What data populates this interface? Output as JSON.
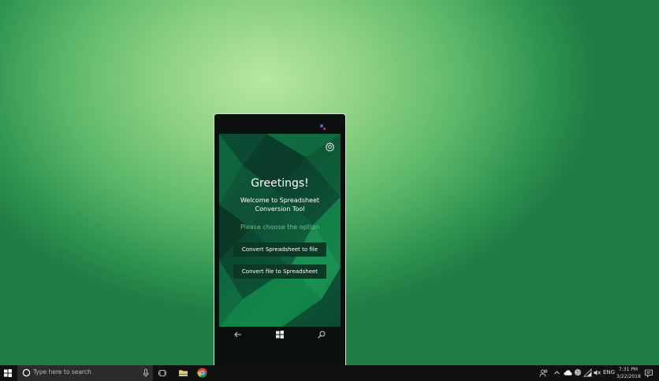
{
  "app": {
    "greeting": "Greetings!",
    "welcome_line1": "Welcome to Spreadsheet",
    "welcome_line2": "Conversion Tool",
    "choose_prompt": "Please choose the option",
    "buttons": {
      "convert_to_file": "Convert Spreadsheet to file",
      "convert_to_sheet": "Convert file to Spreadsheet"
    },
    "icons": {
      "settings": "gear-icon",
      "back": "back-arrow-icon",
      "home": "windows-logo-icon",
      "search": "search-icon"
    }
  },
  "taskbar": {
    "search_placeholder": "Type here to search",
    "language": "ENG",
    "time": "7:31 PM",
    "date": "3/22/2018",
    "icons": [
      "windows-logo-icon",
      "cortana-icon",
      "microphone-icon",
      "task-view-icon",
      "file-explorer-icon",
      "chrome-icon",
      "people-icon",
      "chevron-up-icon",
      "onedrive-icon",
      "globe-icon",
      "wifi-icon",
      "volume-icon",
      "notification-icon"
    ]
  },
  "colors": {
    "desktop_light": "#b8e8a0",
    "desktop_dark": "#1f7d45",
    "button_bg": "#0c3826",
    "prompt_text": "#6fbf8a",
    "taskbar_bg": "#101211"
  }
}
